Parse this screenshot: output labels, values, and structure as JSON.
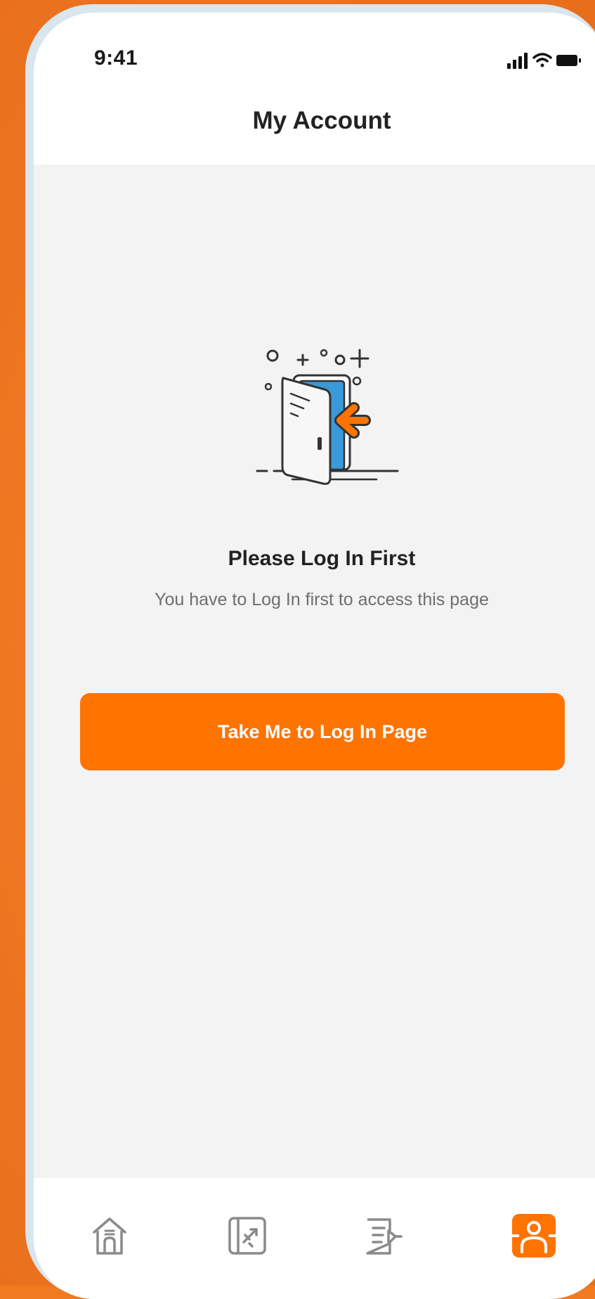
{
  "status_bar": {
    "time": "9:41",
    "icons": [
      "cellular-signal-icon",
      "wifi-icon",
      "battery-icon"
    ]
  },
  "header": {
    "title": "My Account"
  },
  "empty_state": {
    "illustration": "door-login-illustration",
    "title": "Please Log In First",
    "message": "You have to Log In first to access this page"
  },
  "actions": {
    "login_button_label": "Take Me to Log In Page"
  },
  "bottom_nav": {
    "items": [
      {
        "icon": "home-icon",
        "active": false
      },
      {
        "icon": "flight-bookings-icon",
        "active": false
      },
      {
        "icon": "orders-list-icon",
        "active": false
      },
      {
        "icon": "account-icon",
        "active": true
      }
    ]
  },
  "colors": {
    "accent": "#FF7300",
    "background_orange": "#EF7A20",
    "screen_background": "#F3F3F3",
    "illustration_blue": "#3A9AD9",
    "inactive_icon": "#8A8A8A"
  }
}
